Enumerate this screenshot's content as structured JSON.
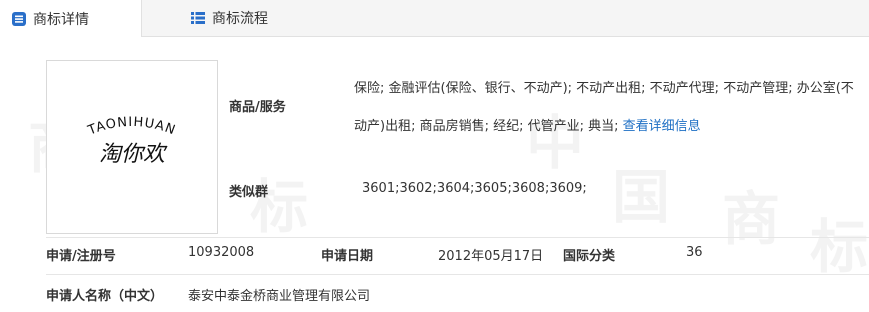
{
  "tabs": [
    {
      "label": "商标详情",
      "icon": "document-list-icon",
      "active": true
    },
    {
      "label": "商标流程",
      "icon": "list-icon",
      "active": false
    }
  ],
  "watermark": {
    "chars": [
      "商",
      "标",
      "中",
      "国",
      "商",
      "标"
    ]
  },
  "logo": {
    "latin": "TAONIHUAN",
    "chinese": "淘你欢"
  },
  "goods_services": {
    "label": "商品/服务",
    "text": "保险; 金融评估(保险、银行、不动产); 不动产出租; 不动产代理; 不动产管理; 办公室(不动产)出租; 商品房销售; 经纪; 代管产业; 典当;",
    "link": "查看详细信息"
  },
  "similar_group": {
    "label": "类似群",
    "value": "3601;3602;3604;3605;3608;3609;"
  },
  "registration": {
    "reg_no_label": "申请/注册号",
    "reg_no": "10932008",
    "date_label": "申请日期",
    "date": "2012年05月17日",
    "class_label": "国际分类",
    "class": "36"
  },
  "applicant": {
    "label": "申请人名称（中文）",
    "value": "泰安中泰金桥商业管理有限公司"
  },
  "colors": {
    "link": "#1e6fc4",
    "tab_icon": "#2a6fc9",
    "tabbar_bg": "#f5f5f5"
  }
}
